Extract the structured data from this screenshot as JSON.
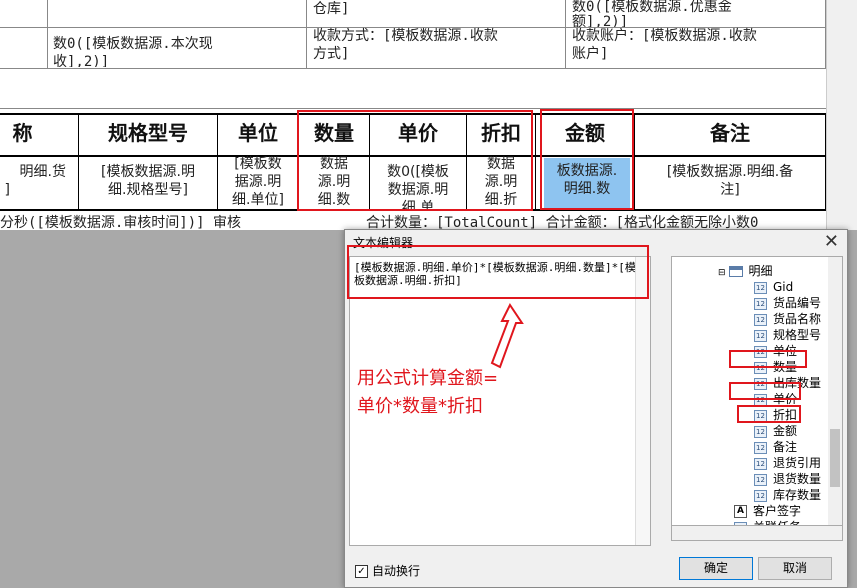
{
  "report": {
    "top_frag_1": "仓库]",
    "top_frag_2": "数0([模板数据源.优惠金",
    "top_frag_3": "额],2)]",
    "row2_a": "数0([模板数据源.本次现",
    "row2_b": "收],2)]",
    "payment_method": "收款方式：[模板数据源.收款",
    "payment_method_2": "方式]",
    "payment_account": "收款账户：[模板数据源.收款",
    "payment_account_2": "账户]",
    "headers": [
      "称",
      "规格型号",
      "单位",
      "数量",
      "单价",
      "折扣",
      "金额",
      "备注"
    ],
    "detail": {
      "name_a": "明细.货",
      "name_b": "]",
      "spec_a": "[模板数据源.明",
      "spec_b": "细.规格型号]",
      "unit_a": "[模板数",
      "unit_b": "据源.明",
      "unit_c": "细.单位]",
      "qty_a": "数据",
      "qty_b": "源.明",
      "qty_c": "细.数",
      "price_a": "数0([模板",
      "price_b": "数据源.明",
      "price_c": "细.单",
      "disc_a": "数据",
      "disc_b": "源.明",
      "disc_c": "细.折",
      "amount_a": "板数据源.",
      "amount_b": "明细.数",
      "remark_a": "[模板数据源.明细.备",
      "remark_b": "注]"
    },
    "bottom_left": "分秒([模板数据源.审核时间])] 审核",
    "bottom_right": "合计数量：[TotalCount] 合计金额：[格式化金额无除小数0"
  },
  "dialog": {
    "title": "文本编辑器",
    "formula": "[模板数据源.明细.单价]*[模板数据源.明细.数量]*[模板数据源.明细.折扣]",
    "note_line1": "用公式计算金额=",
    "note_line2": "单价*数量*折扣",
    "tree": {
      "group": "明细",
      "fields": [
        "Gid",
        "货品编号",
        "货品名称",
        "规格型号",
        "单位",
        "数量",
        "出库数量",
        "单价",
        "折扣",
        "金额",
        "备注",
        "退货引用",
        "退货数量",
        "库存数量"
      ],
      "extra": [
        "客户签字",
        "关联任务"
      ]
    },
    "auto_wrap": "自动换行",
    "ok": "确定",
    "cancel": "取消"
  },
  "colors": {
    "highlight": "#e0161d",
    "selected_cell": "#8ec4f0"
  }
}
